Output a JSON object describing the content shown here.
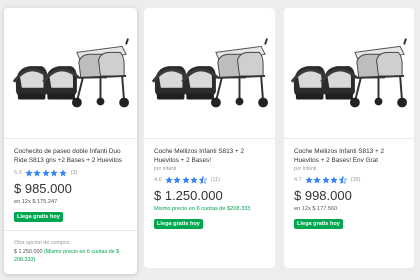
{
  "colors": {
    "accent_green": "#00a650",
    "star_blue": "#3483fa",
    "page_bg": "#ededed"
  },
  "products": [
    {
      "image_icon": "double-stroller-with-two-car-seats-image",
      "title": "Cochecito de paseo doble Infanti Duo Ride S813 gris +2 Bases + 2 Huevitos",
      "seller": "",
      "rating": "5.0",
      "stars": 5,
      "reviews": "(3)",
      "price": "$ 985.000",
      "installments": "en 12x $ 175.247",
      "badge": "Llega gratis hoy",
      "other_label": "Otra opción de compra:",
      "other_price": "$ 1.250.000",
      "other_installments": "Mismo precio en 6 cuotas de $ 208.333"
    },
    {
      "image_icon": "double-stroller-with-two-car-seats-image",
      "title": "Coche Mellizos Infanti S813 + 2 Huevitos + 2 Bases!",
      "seller": "por Infanti",
      "rating": "4.6",
      "stars": 4.5,
      "reviews": "(11)",
      "price": "$ 1.250.000",
      "installments": "Mismo precio en 6 cuotas de $208.333",
      "badge": "Llega gratis hoy"
    },
    {
      "image_icon": "double-stroller-with-two-car-seats-image",
      "title": "Coche Mellizos Infanti S813 + 2 Huevitos + 2 Bases! Env Grat",
      "seller": "por Infanti",
      "rating": "4.7",
      "stars": 4.5,
      "reviews": "(39)",
      "price": "$ 998.000",
      "installments": "en 12x $ 177.560",
      "badge": "Llega gratis hoy"
    }
  ]
}
